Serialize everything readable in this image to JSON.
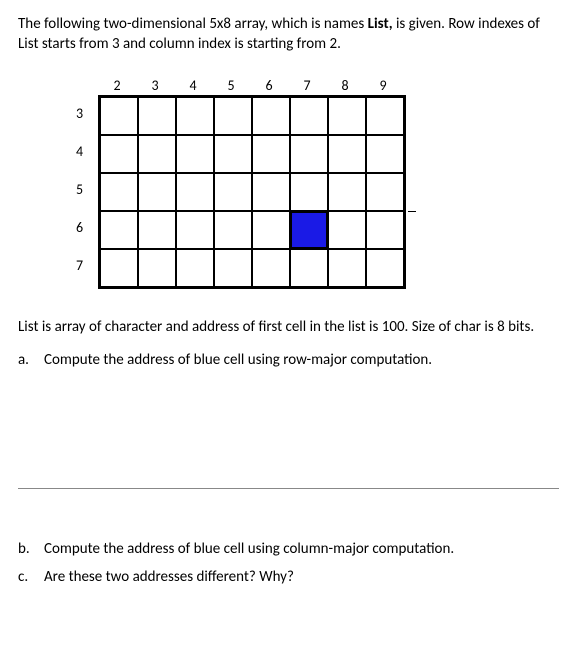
{
  "intro": {
    "pre": "The following two-dimensional 5x8 array, which is names ",
    "bold": "List,",
    "post": " is given. Row indexes of List starts from 3 and column index is starting from 2."
  },
  "grid": {
    "col_headers": [
      "2",
      "3",
      "4",
      "5",
      "6",
      "7",
      "8",
      "9"
    ],
    "row_headers": [
      "3",
      "4",
      "5",
      "6",
      "7"
    ],
    "blue_cell": {
      "row": 6,
      "col": 7
    }
  },
  "body_text": "List is array of character and address of first cell in the list is 100. Size of char is 8 bits.",
  "questions": {
    "a": {
      "marker": "a.",
      "text": "Compute the address of blue cell using row-major computation."
    },
    "b": {
      "marker": "b.",
      "text": "Compute the address of blue cell using column-major computation."
    },
    "c": {
      "marker": "c.",
      "text": "Are these two addresses different? Why?"
    }
  }
}
